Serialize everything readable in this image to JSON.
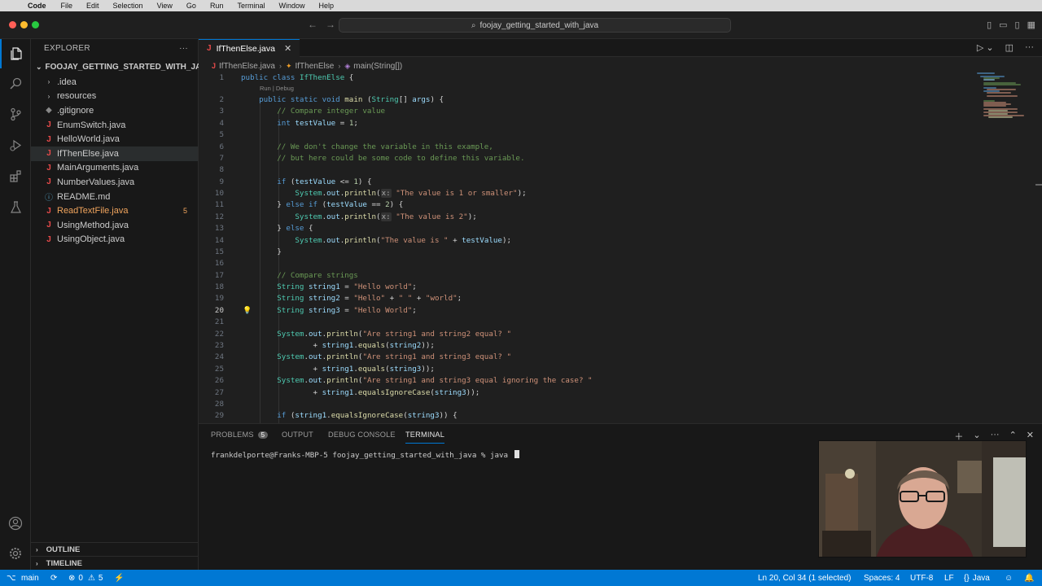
{
  "menubar": {
    "app_name": "Code",
    "items": [
      "File",
      "Edit",
      "Selection",
      "View",
      "Go",
      "Run",
      "Terminal",
      "Window",
      "Help"
    ]
  },
  "titlebar": {
    "search_text": "foojay_getting_started_with_java"
  },
  "sidebar": {
    "title": "EXPLORER",
    "project_name": "FOOJAY_GETTING_STARTED_WITH_JAVA",
    "items": [
      {
        "label": ".idea",
        "kind": "folder"
      },
      {
        "label": "resources",
        "kind": "folder"
      },
      {
        "label": ".gitignore",
        "kind": "git"
      },
      {
        "label": "EnumSwitch.java",
        "kind": "java"
      },
      {
        "label": "HelloWorld.java",
        "kind": "java"
      },
      {
        "label": "IfThenElse.java",
        "kind": "java",
        "selected": true
      },
      {
        "label": "MainArguments.java",
        "kind": "java"
      },
      {
        "label": "NumberValues.java",
        "kind": "java"
      },
      {
        "label": "README.md",
        "kind": "md"
      },
      {
        "label": "ReadTextFile.java",
        "kind": "java",
        "error": true,
        "badge": "5"
      },
      {
        "label": "UsingMethod.java",
        "kind": "java"
      },
      {
        "label": "UsingObject.java",
        "kind": "java"
      }
    ],
    "outline_label": "OUTLINE",
    "timeline_label": "TIMELINE"
  },
  "editor": {
    "tab_label": "IfThenElse.java",
    "breadcrumb": {
      "file": "IfThenElse.java",
      "class": "IfThenElse",
      "method": "main(String[])"
    },
    "codelens": "Run | Debug",
    "current_line": 20
  },
  "panel": {
    "tabs": [
      {
        "label": "PROBLEMS",
        "count": "5"
      },
      {
        "label": "OUTPUT"
      },
      {
        "label": "DEBUG CONSOLE"
      },
      {
        "label": "TERMINAL",
        "active": true
      }
    ],
    "terminal_prompt": "frankdelporte@Franks-MBP-5 foojay_getting_started_with_java % java "
  },
  "statusbar": {
    "branch": "main",
    "errors": "0",
    "warnings": "5",
    "position": "Ln 20, Col 34 (1 selected)",
    "spaces": "Spaces: 4",
    "encoding": "UTF-8",
    "eol": "LF",
    "language": "Java"
  },
  "colors": {
    "accent": "#0078d4",
    "statusbar": "#0078d4",
    "java_icon": "#e84a4a",
    "warning": "#f0a45d"
  }
}
